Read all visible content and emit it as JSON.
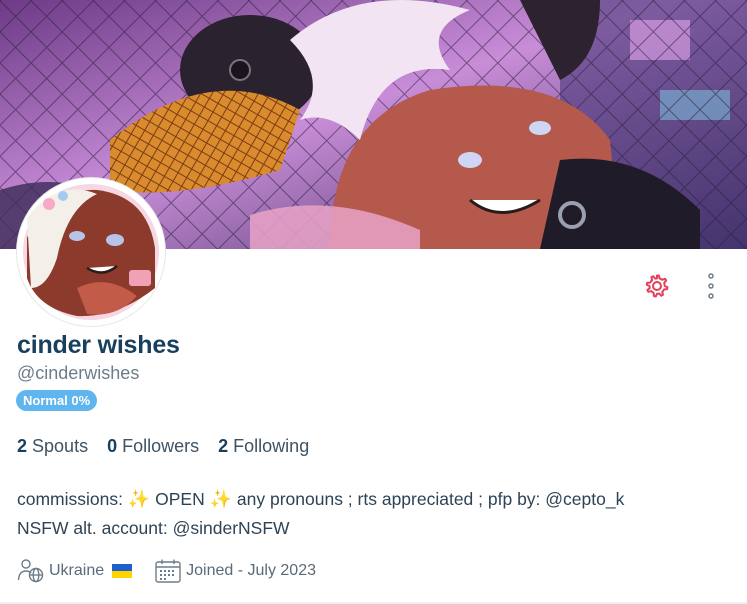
{
  "profile": {
    "display_name": "cinder wishes",
    "handle": "@cinderwishes",
    "badge": "Normal 0%"
  },
  "stats": [
    {
      "count": "2",
      "label": "Spouts"
    },
    {
      "count": "0",
      "label": "Followers"
    },
    {
      "count": "2",
      "label": "Following"
    }
  ],
  "bio": {
    "line1_a": "commissions: ",
    "line1_emoji1": "✨",
    "line1_b": " OPEN ",
    "line1_emoji2": "✨",
    "line1_c": " any pronouns ; rts appreciated ; pfp by: @cepto_k",
    "line2": "NSFW alt. account: @sinderNSFW"
  },
  "meta": {
    "location": "Ukraine",
    "joined": "Joined - July 2023"
  },
  "icons": {
    "settings": "gear-icon",
    "more": "vertical-dots-icon",
    "location": "person-globe-icon",
    "calendar": "calendar-icon"
  },
  "colors": {
    "accent": "#e0405a",
    "badge": "#5fb6ee",
    "name": "#183f5c"
  }
}
